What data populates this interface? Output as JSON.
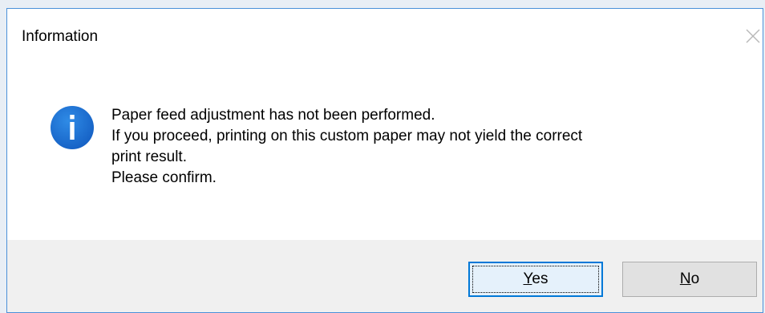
{
  "window": {
    "title": "Information"
  },
  "icons": {
    "info": "info-icon",
    "close": "close-icon"
  },
  "colors": {
    "info_icon_fill": "#1a6fd0",
    "primary_border": "#0078d7",
    "footer_bg": "#f0f0f0"
  },
  "message": {
    "lines": [
      "Paper feed adjustment has not been performed.",
      "If you proceed, printing on this custom paper may not yield the correct",
      "print result.",
      "Please confirm."
    ]
  },
  "buttons": {
    "yes": {
      "accel": "Y",
      "rest": "es"
    },
    "no": {
      "accel": "N",
      "rest": "o"
    }
  }
}
